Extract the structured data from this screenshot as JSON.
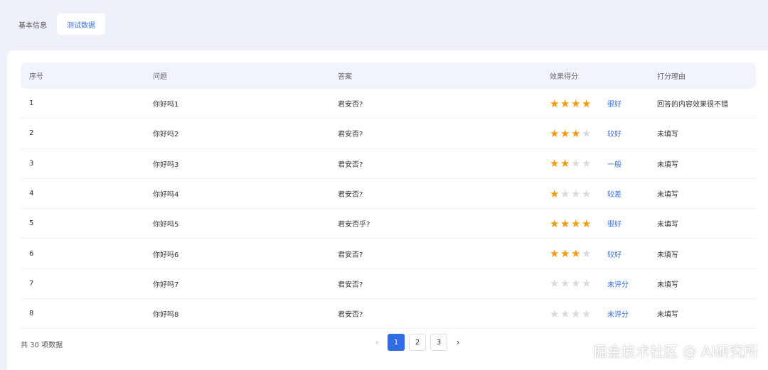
{
  "tabs": [
    {
      "label": "基本信息",
      "active": false
    },
    {
      "label": "测试数据",
      "active": true
    }
  ],
  "table": {
    "headers": [
      "序号",
      "问题",
      "答案",
      "效果得分",
      "打分理由"
    ],
    "rows": [
      {
        "index": "1",
        "question": "你好吗1",
        "answer": "君安否?",
        "stars": 4,
        "rating": "很好",
        "reason": "回答的内容效果很不错"
      },
      {
        "index": "2",
        "question": "你好吗2",
        "answer": "君安否?",
        "stars": 3,
        "rating": "较好",
        "reason": "未填写"
      },
      {
        "index": "3",
        "question": "你好吗3",
        "answer": "君安否?",
        "stars": 2,
        "rating": "一般",
        "reason": "未填写"
      },
      {
        "index": "4",
        "question": "你好吗4",
        "answer": "君安否?",
        "stars": 1,
        "rating": "较差",
        "reason": "未填写"
      },
      {
        "index": "5",
        "question": "你好吗5",
        "answer": "君安否乎?",
        "stars": 4,
        "rating": "很好",
        "reason": "未填写"
      },
      {
        "index": "6",
        "question": "你好吗6",
        "answer": "君安否?",
        "stars": 3,
        "rating": "较好",
        "reason": "未填写"
      },
      {
        "index": "7",
        "question": "你好吗7",
        "answer": "君安否?",
        "stars": 0,
        "rating": "未评分",
        "reason": "未填写"
      },
      {
        "index": "8",
        "question": "你好吗8",
        "answer": "君安否?",
        "stars": 0,
        "rating": "未评分",
        "reason": "未填写"
      }
    ],
    "max_stars": 4
  },
  "footer": {
    "total_text": "共 30 项数据",
    "pages": [
      "1",
      "2",
      "3"
    ],
    "current_page": "1",
    "prev_icon": "chevron-left-icon",
    "next_icon": "chevron-right-icon"
  },
  "watermark": "掘金技术社区 @ AI研究所",
  "colors": {
    "accent": "#2f6ce5",
    "star_on": "#f59a0c",
    "star_off": "#d9dbe0",
    "link": "#3a6fd8"
  }
}
